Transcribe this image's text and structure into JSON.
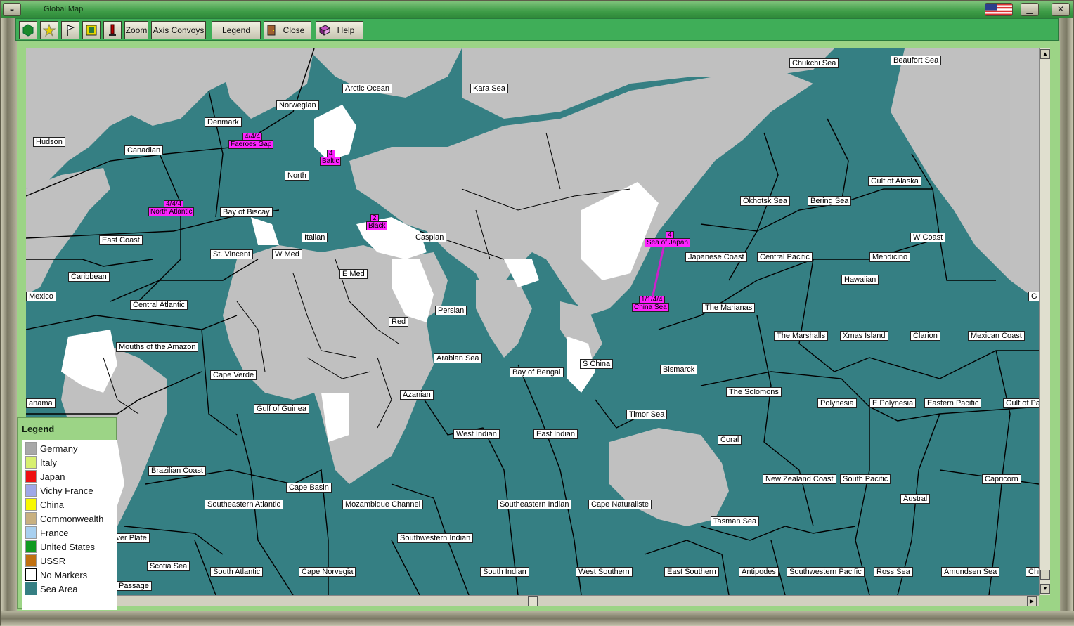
{
  "window": {
    "title": "Global Map"
  },
  "toolbar": {
    "zoom_label": "Zoom",
    "axis_convoys_label": "Axis Convoys",
    "legend_label": "Legend",
    "close_label": "Close",
    "help_label": "Help"
  },
  "legend": {
    "title": "Legend",
    "items": [
      {
        "label": "Germany",
        "color": "#a8a8a8"
      },
      {
        "label": "Italy",
        "color": "#d8f070"
      },
      {
        "label": "Japan",
        "color": "#ee1111"
      },
      {
        "label": "Vichy France",
        "color": "#9fa8e8"
      },
      {
        "label": "China",
        "color": "#f8f800"
      },
      {
        "label": "Commonwealth",
        "color": "#c8b080"
      },
      {
        "label": "France",
        "color": "#a8d0f0"
      },
      {
        "label": "United States",
        "color": "#109a20"
      },
      {
        "label": "USSR",
        "color": "#c07010"
      },
      {
        "label": "No Markers",
        "color": "#ffffff"
      },
      {
        "label": "Sea Area",
        "color": "#357f83"
      }
    ]
  },
  "colors": {
    "sea": "#357f83",
    "axis_land": "#c0c0c0",
    "neutral_land": "#ffffff",
    "unit_marker": "#ff22ff",
    "frame_green": "#3fae58"
  },
  "units": [
    {
      "count": "4/4/4",
      "label": "Faeroes Gap"
    },
    {
      "count": "4",
      "label": "Baltic"
    },
    {
      "count": "4/4/4",
      "label": "North Atlantic"
    },
    {
      "count": "2",
      "label": "Black"
    },
    {
      "count": "4",
      "label": "Sea of Japan"
    },
    {
      "count": "1/1/4/4",
      "label": "China Sea"
    }
  ],
  "seas": {
    "chukchi": "Chukchi Sea",
    "beaufort": "Beaufort Sea",
    "arctic": "Arctic Ocean",
    "kara": "Kara Sea",
    "norwegian": "Norwegian",
    "denmark": "Denmark",
    "hudson": "Hudson",
    "canadian": "Canadian",
    "north": "North",
    "biscay": "Bay of Biscay",
    "italian": "Italian",
    "caspian": "Caspian",
    "okhotsk": "Okhotsk Sea",
    "bering": "Bering Sea",
    "alaska": "Gulf of Alaska",
    "wcoast": "W Coast",
    "eastcoast": "East Coast",
    "stvincent": "St. Vincent",
    "wmed": "W Med",
    "emed": "E Med",
    "japcoast": "Japanese Coast",
    "centpac": "Central Pacific",
    "mendicino": "Mendicino",
    "caribbean": "Caribbean",
    "hawaiian": "Hawaiian",
    "mexico": "Mexico",
    "centatl": "Central Atlantic",
    "persian": "Persian",
    "marianas": "The Marianas",
    "g": "G",
    "red": "Red",
    "marshalls": "The Marshalls",
    "xmas": "Xmas Island",
    "clarion": "Clarion",
    "mexcoast": "Mexican Coast",
    "amazon": "Mouths of the Amazon",
    "arabian": "Arabian Sea",
    "schina": "S China",
    "bengal": "Bay of Bengal",
    "bismarck": "Bismarck",
    "capeverde": "Cape Verde",
    "azanian": "Azanian",
    "solomons": "The Solomons",
    "panama": "anama",
    "polynesia": "Polynesia",
    "epolynesia": "E Polynesia",
    "eastpac": "Eastern Pacific",
    "gulfpa": "Gulf of Pa",
    "guinea": "Gulf of Guinea",
    "timor": "Timor Sea",
    "westind": "West Indian",
    "eastind": "East Indian",
    "coral": "Coral",
    "brazil": "Brazilian Coast",
    "nzcoast": "New Zealand Coast",
    "southpac": "South Pacific",
    "capricorn": "Capricorn",
    "capebasin": "Cape Basin",
    "austral": "Austral",
    "seatl": "Southeastern Atlantic",
    "mozambique": "Mozambique Channel",
    "seind": "Southeastern Indian",
    "capenat": "Cape Naturaliste",
    "tasman": "Tasman Sea",
    "plate": "iver Plate",
    "swind": "Southwestern Indian",
    "scotia": "Scotia Sea",
    "southatl": "South Atlantic",
    "capenor": "Cape Norvegia",
    "southind": "South Indian",
    "westsouth": "West Southern",
    "eastsouth": "East Southern",
    "antipodes": "Antipodes",
    "swpac": "Southwestern Pacific",
    "ross": "Ross Sea",
    "amundsen": "Amundsen Sea",
    "chi": "Chi",
    "passage": "Passage"
  }
}
